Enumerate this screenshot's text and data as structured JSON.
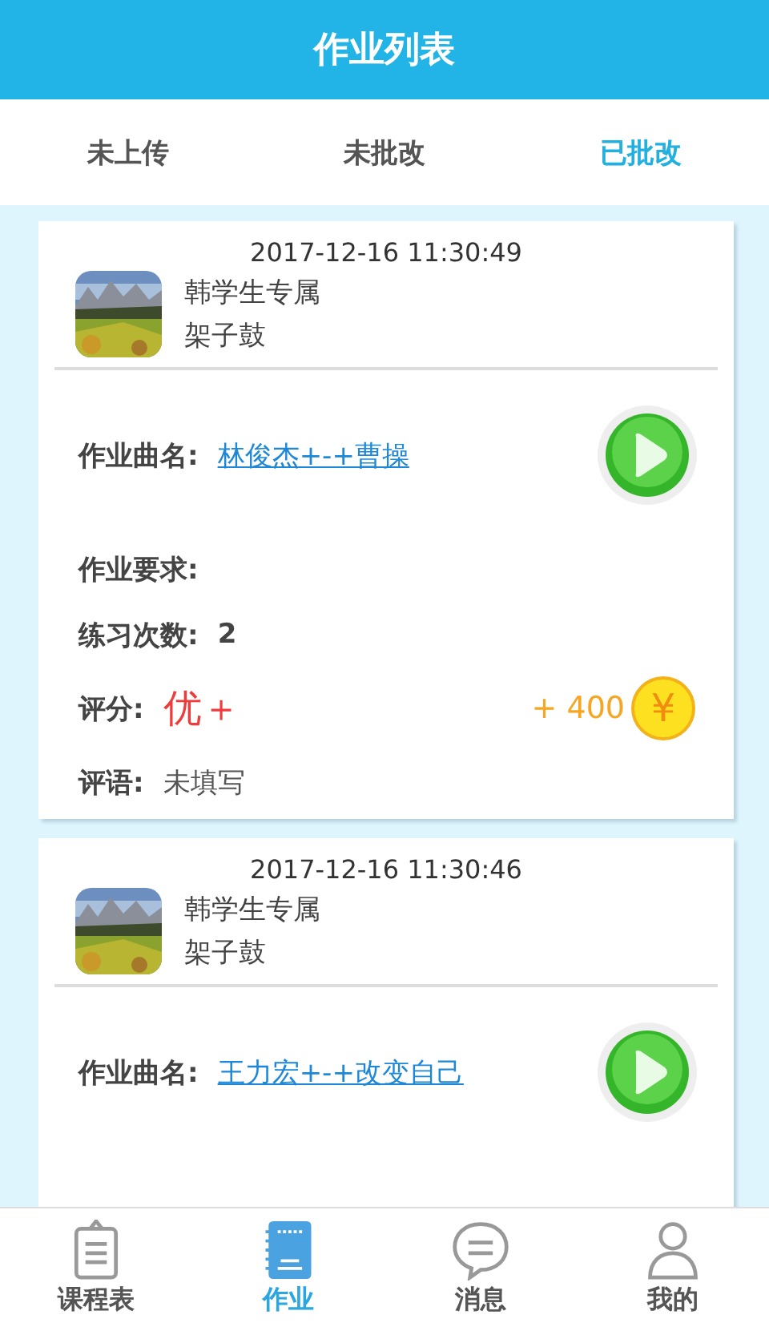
{
  "header": {
    "title": "作业列表"
  },
  "tabs": [
    {
      "label": "未上传",
      "selected": false
    },
    {
      "label": "未批改",
      "selected": false
    },
    {
      "label": "已批改",
      "selected": true
    }
  ],
  "cards": [
    {
      "time": "2017-12-16 11:30:49",
      "title": "韩学生专属",
      "subtitle": "架子鼓",
      "song_label": "作业曲名:",
      "song": "林俊杰+-+曹操",
      "requirement_label": "作业要求:",
      "practice_label": "练习次数:",
      "practice_count": "2",
      "score_label": "评分:",
      "score": "优＋",
      "coins": "+ 400",
      "coin_symbol": "¥",
      "comment_label": "评语:",
      "comment": "未填写"
    },
    {
      "time": "2017-12-16 11:30:46",
      "title": "韩学生专属",
      "subtitle": "架子鼓",
      "song_label": "作业曲名:",
      "song": "王力宏+-+改变自己"
    }
  ],
  "bottom_nav": [
    {
      "label": "课程表",
      "kind": "schedule",
      "selected": false
    },
    {
      "label": "作业",
      "kind": "note",
      "selected": true
    },
    {
      "label": "消息",
      "kind": "message",
      "selected": false
    },
    {
      "label": "我的",
      "kind": "profile",
      "selected": false
    }
  ]
}
